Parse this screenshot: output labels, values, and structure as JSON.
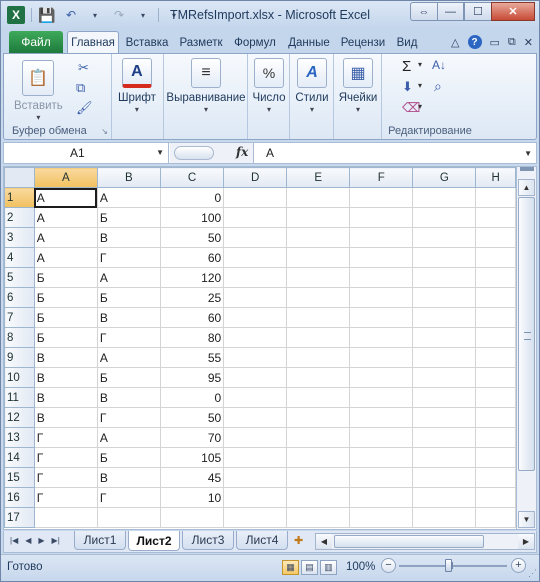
{
  "window": {
    "title": "TMRefsImport.xlsx  -  Microsoft Excel",
    "restore_icon": "⇔",
    "minimize_icon": "—",
    "maximize_icon": "☐",
    "close_icon": "✕"
  },
  "qat": {
    "app_icon": "X",
    "save_icon": "💾",
    "undo_icon": "↶",
    "redo_icon": "↷",
    "dropdown_icon": "▾"
  },
  "tabs": {
    "file": "Файл",
    "items": [
      "Главная",
      "Вставка",
      "Разметк",
      "Формул",
      "Данные",
      "Рецензи",
      "Вид"
    ]
  },
  "ribbon": {
    "clipboard": {
      "paste_label": "Вставить",
      "group_label": "Буфер обмена",
      "cut_icon": "✂",
      "copy_icon": "⧉",
      "painter_icon": "🖌"
    },
    "font": {
      "label": "Шрифт",
      "icon": "A"
    },
    "alignment": {
      "label": "Выравнивание",
      "icon": "≡"
    },
    "number": {
      "label": "Число",
      "icon": "%"
    },
    "styles": {
      "label": "Стили",
      "icon": "A"
    },
    "cells": {
      "label": "Ячейки",
      "icon": "▦"
    },
    "editing": {
      "group_label": "Редактирование",
      "sum_icon": "Σ",
      "sort_icon": "A↓",
      "fill_icon": "⬇",
      "find_icon": "⌕",
      "clear_icon": "⌫"
    }
  },
  "formula_bar": {
    "name_box": "A1",
    "fx": "fx",
    "value": "А"
  },
  "grid": {
    "columns": [
      "A",
      "B",
      "C",
      "D",
      "E",
      "F",
      "G",
      "H"
    ],
    "rows": [
      {
        "n": "1",
        "a": "А",
        "b": "А",
        "c": "0"
      },
      {
        "n": "2",
        "a": "А",
        "b": "Б",
        "c": "100"
      },
      {
        "n": "3",
        "a": "А",
        "b": "В",
        "c": "50"
      },
      {
        "n": "4",
        "a": "А",
        "b": "Г",
        "c": "60"
      },
      {
        "n": "5",
        "a": "Б",
        "b": "А",
        "c": "120"
      },
      {
        "n": "6",
        "a": "Б",
        "b": "Б",
        "c": "25"
      },
      {
        "n": "7",
        "a": "Б",
        "b": "В",
        "c": "60"
      },
      {
        "n": "8",
        "a": "Б",
        "b": "Г",
        "c": "80"
      },
      {
        "n": "9",
        "a": "В",
        "b": "А",
        "c": "55"
      },
      {
        "n": "10",
        "a": "В",
        "b": "Б",
        "c": "95"
      },
      {
        "n": "11",
        "a": "В",
        "b": "В",
        "c": "0"
      },
      {
        "n": "12",
        "a": "В",
        "b": "Г",
        "c": "50"
      },
      {
        "n": "13",
        "a": "Г",
        "b": "А",
        "c": "70"
      },
      {
        "n": "14",
        "a": "Г",
        "b": "Б",
        "c": "105"
      },
      {
        "n": "15",
        "a": "Г",
        "b": "В",
        "c": "45"
      },
      {
        "n": "16",
        "a": "Г",
        "b": "Г",
        "c": "10"
      },
      {
        "n": "17",
        "a": "",
        "b": "",
        "c": ""
      }
    ]
  },
  "sheets": {
    "tabs": [
      "Лист1",
      "Лист2",
      "Лист3",
      "Лист4"
    ],
    "active": "Лист2"
  },
  "status": {
    "ready": "Готово",
    "zoom": "100%",
    "zoom_minus": "−",
    "zoom_plus": "+"
  }
}
